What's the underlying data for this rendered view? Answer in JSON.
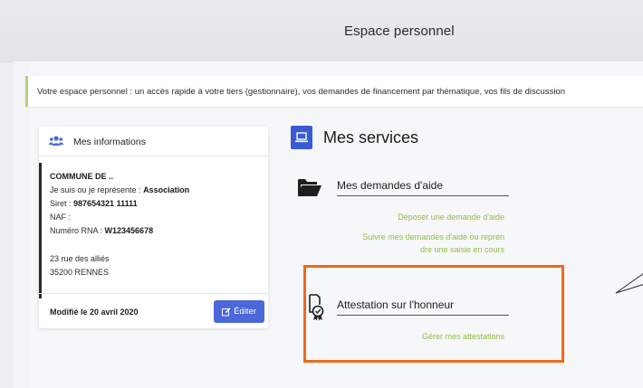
{
  "header": {
    "title": "Espace personnel"
  },
  "banner": {
    "text": "Votre espace personnel : un accès rapide à votre tiers (gestionnaire), vos demandes de financement par thématique, vos fils de discussion"
  },
  "info_card": {
    "title": "Mes informations",
    "icon": "users-icon",
    "name": "COMMUNE DE ..",
    "represent_label": "Je suis ou je représente : ",
    "represent_value": "Association",
    "siret_label": "Siret : ",
    "siret_value": "987654321 11111",
    "naf_label": "NAF :",
    "rna_label": "Numéro RNA : ",
    "rna_value": "W123456678",
    "address_line1": "23 rue des alliés",
    "address_line2": "35200 RENNES",
    "modified": "Modifié le 20 avril 2020",
    "edit_label": "Éditer"
  },
  "services": {
    "title": "Mes services",
    "icon": "laptop-icon",
    "aid": {
      "icon": "folder-open-icon",
      "title": "Mes demandes d'aide",
      "link1": "Déposer une demande d'aide",
      "link2_line1": "Suivre mes demandes d'aide ou repren",
      "link2_line2": "dre une saisie en cours"
    },
    "attestation": {
      "icon": "certificate-icon",
      "title": "Attestation sur l'honneur",
      "link": "Gérer mes attestations"
    }
  },
  "colors": {
    "accent_blue": "#3b5bd3",
    "link_green": "#8cbf42",
    "highlight_orange": "#ec6b1c",
    "banner_border": "#b2d67a"
  }
}
